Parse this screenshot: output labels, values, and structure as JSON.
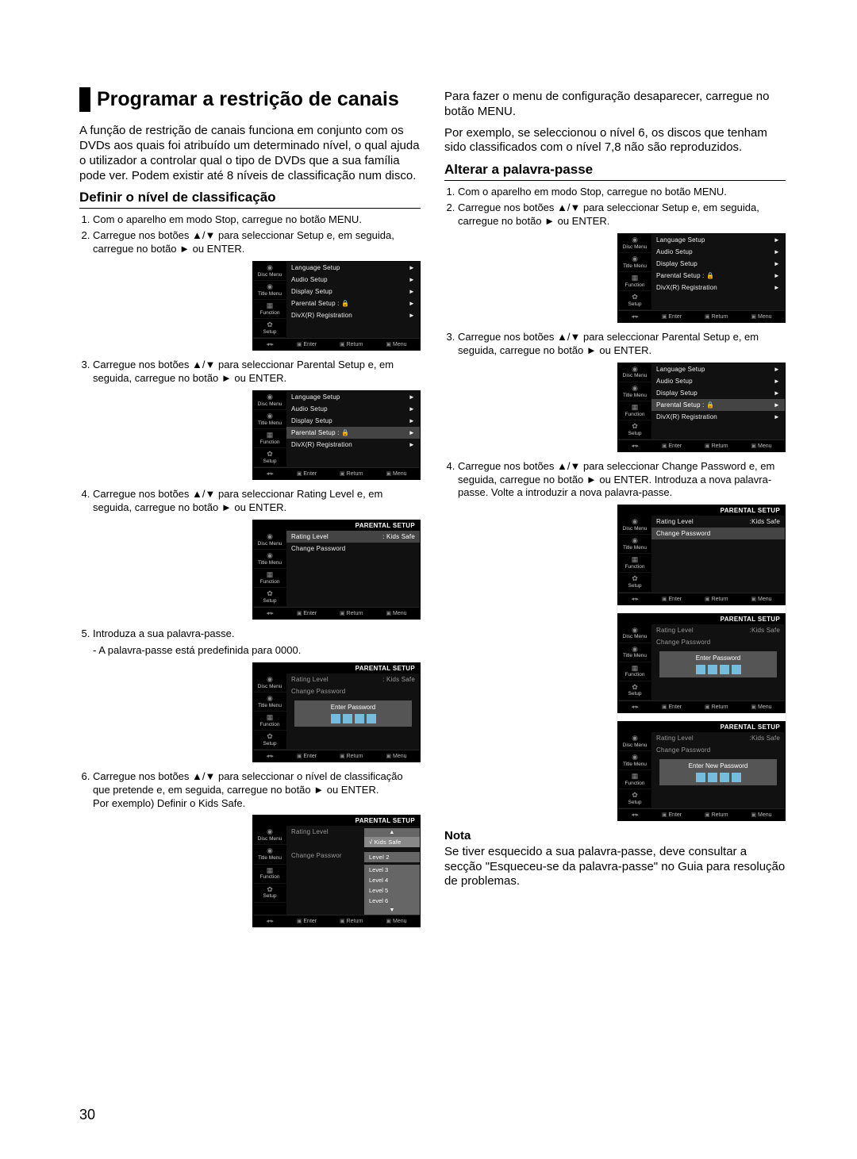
{
  "page_number": "30",
  "left": {
    "title": "Programar a restrição de canais",
    "intro": "A função de restrição de canais funciona em conjunto com os DVDs aos quais foi atribuído um determinado nível, o qual ajuda o utilizador a controlar qual o tipo de DVDs que a sua família pode ver. Podem existir até 8 níveis de classificação num disco.",
    "h2a": "Definir o nível de classificação",
    "s1": "Com o aparelho em modo Stop, carregue no botão MENU.",
    "s2": "Carregue nos botões ▲/▼ para seleccionar Setup e, em seguida, carregue no botão ► ou ENTER.",
    "s3": "Carregue nos botões ▲/▼ para seleccionar Parental Setup e, em seguida, carregue no botão ► ou ENTER.",
    "s4": "Carregue nos botões ▲/▼ para seleccionar Rating Level e, em seguida, carregue no botão ► ou ENTER.",
    "s5": "Introduza a sua palavra-passe.",
    "s5b": "- A palavra-passe está predefinida para 0000.",
    "s6": "Carregue nos botões ▲/▼ para seleccionar o nível  de classificação que pretende e, em seguida,  carregue no botão ► ou ENTER.",
    "s6b": "Por exemplo) Definir o Kids Safe."
  },
  "right": {
    "p1": "Para fazer o menu de configuração desaparecer, carregue no botão MENU.",
    "p2": "Por exemplo, se seleccionou o nível 6, os discos que tenham sido classificados com o nível 7,8 não são reproduzidos.",
    "h2b": "Alterar a palavra-passe",
    "s1": "Com o aparelho em modo Stop, carregue no botão MENU.",
    "s2": "Carregue nos botões ▲/▼ para seleccionar Setup e, em seguida, carregue no botão ► ou ENTER.",
    "s3": "Carregue nos botões ▲/▼ para seleccionar Parental Setup e, em seguida, carregue no botão ► ou ENTER.",
    "s4": "Carregue nos botões ▲/▼ para seleccionar Change Password e, em seguida, carregue no botão ► ou ENTER. Introduza a nova palavra-passe. Volte a introduzir a nova palavra-passe.",
    "nota_h": "Nota",
    "nota": "Se tiver esquecido a sua palavra-passe, deve consultar a secção \"Esqueceu-se da palavra-passe\" no Guia para resolução de problemas."
  },
  "osd": {
    "side": {
      "disc": "Disc Menu",
      "title": "Title Menu",
      "func": "Function",
      "setup": "Setup"
    },
    "rows": {
      "lang": "Language Setup",
      "audio": "Audio Setup",
      "display": "Display Setup",
      "parental": "Parental Setup :",
      "divx": "DivX(R) Registration"
    },
    "parental_header": "PARENTAL  SETUP",
    "rating": "Rating Level",
    "kids": ": Kids Safe",
    "kids2": ":Kids Safe",
    "change": "Change Password",
    "change_short": "Change Passwor",
    "enter_pw": "Enter Password",
    "enter_new_pw": "Enter New Password",
    "footer": {
      "enter": "Enter",
      "return": "Return",
      "menu": "Menu"
    },
    "levels": [
      "Kids Safe",
      "Level 2",
      "Level 3",
      "Level 4",
      "Level 5",
      "Level 6"
    ]
  }
}
